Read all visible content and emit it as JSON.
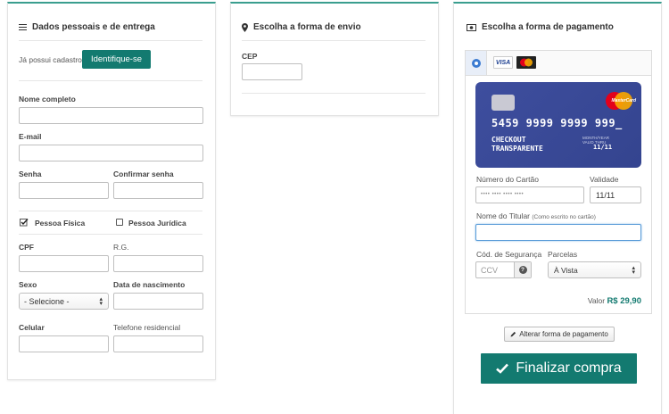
{
  "personal": {
    "title": "Dados pessoais e de entrega",
    "already_registered": "Já possui cadastro?",
    "identify_button": "Identifique-se",
    "full_name_label": "Nome completo",
    "email_label": "E-mail",
    "password_label": "Senha",
    "confirm_password_label": "Confirmar senha",
    "person_physical": "Pessoa Física",
    "person_legal": "Pessoa Jurídica",
    "cpf_label": "CPF",
    "rg_label": "R.G.",
    "sex_label": "Sexo",
    "sex_select": "- Selecione -",
    "birth_label": "Data de nascimento",
    "mobile_label": "Celular",
    "home_phone_label": "Telefone residencial"
  },
  "shipping": {
    "title": "Escolha a forma de envio",
    "cep_label": "CEP"
  },
  "payment": {
    "title": "Escolha a forma de pagamento",
    "visa_label": "VISA",
    "card": {
      "number": "5459 9999 9999 999_",
      "holder_line1": "CHECKOUT",
      "holder_line2": "TRANSPARENTE",
      "valid_small": "MONTH/YEAR VALID THRU",
      "valid": "11/11",
      "brand": "MasterCard"
    },
    "card_number_label": "Número do Cartão",
    "card_number_placeholder": "•••• •••• •••• ••••",
    "validity_label": "Validade",
    "validity_value": "11/11",
    "holder_label": "Nome do Titular",
    "holder_hint": "(Como escrito no cartão)",
    "security_label": "Cód. de Segurança",
    "security_placeholder": "CCV",
    "installments_label": "Parcelas",
    "installments_value": "À Vista",
    "value_label": "Valor",
    "value_amount": "R$ 29,90",
    "change_button": "Alterar forma de pagamento",
    "finalize_button": "Finalizar compra"
  },
  "colors": {
    "accent": "#137a70",
    "card_blue": "#3e4e9e",
    "focus_blue": "#5b9dd9"
  }
}
